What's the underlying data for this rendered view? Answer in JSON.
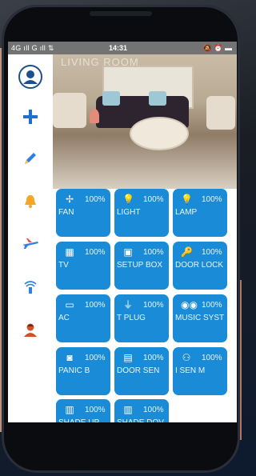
{
  "statusbar": {
    "left": "4G ıll  G ıll ⇅",
    "time": "14:31",
    "right": "🔕 ⏰ ▬"
  },
  "room": {
    "title": "LIVING ROOM"
  },
  "sidebar": {
    "items": [
      {
        "name": "profile",
        "icon": "avatar-icon"
      },
      {
        "name": "add",
        "icon": "plus-icon"
      },
      {
        "name": "edit",
        "icon": "pencil-icon"
      },
      {
        "name": "alarm",
        "icon": "bell-icon"
      },
      {
        "name": "plane",
        "icon": "airplane-icon"
      },
      {
        "name": "signal",
        "icon": "signal-icon"
      },
      {
        "name": "user",
        "icon": "person-icon"
      }
    ]
  },
  "devices": [
    {
      "label": "FAN",
      "percent": "100%",
      "icon": "fan-icon",
      "glyph": "✢"
    },
    {
      "label": "LIGHT",
      "percent": "100%",
      "icon": "bulb-icon",
      "glyph": "💡"
    },
    {
      "label": "LAMP",
      "percent": "100%",
      "icon": "lamp-icon",
      "glyph": "💡"
    },
    {
      "label": "TV",
      "percent": "100%",
      "icon": "tv-icon",
      "glyph": "▦"
    },
    {
      "label": "SETUP BOX",
      "percent": "100%",
      "icon": "setupbox-icon",
      "glyph": "▣"
    },
    {
      "label": "DOOR LOCK",
      "percent": "100%",
      "icon": "doorlock-icon",
      "glyph": "🔑"
    },
    {
      "label": "AC",
      "percent": "100%",
      "icon": "ac-icon",
      "glyph": "▭"
    },
    {
      "label": "T PLUG",
      "percent": "100%",
      "icon": "plug-icon",
      "glyph": "⏚"
    },
    {
      "label": "MUSIC SYST",
      "percent": "100%",
      "icon": "music-icon",
      "glyph": "◉◉"
    },
    {
      "label": "PANIC B",
      "percent": "100%",
      "icon": "panic-icon",
      "glyph": "◙"
    },
    {
      "label": "DOOR SEN",
      "percent": "100%",
      "icon": "doorsensor-icon",
      "glyph": "▤"
    },
    {
      "label": "I SEN     M",
      "percent": "100%",
      "icon": "motion-sensor-icon",
      "glyph": "⚇"
    },
    {
      "label": "SHADE UP",
      "percent": "100%",
      "icon": "shade-up-icon",
      "glyph": "▥"
    },
    {
      "label": "SHADE DOV",
      "percent": "100%",
      "icon": "shade-down-icon",
      "glyph": "▥"
    }
  ],
  "colors": {
    "tile": "#1a8bd6",
    "sidebar_icon": "#1f6fd0",
    "bell": "#f5a623",
    "person": "#d0502a"
  }
}
